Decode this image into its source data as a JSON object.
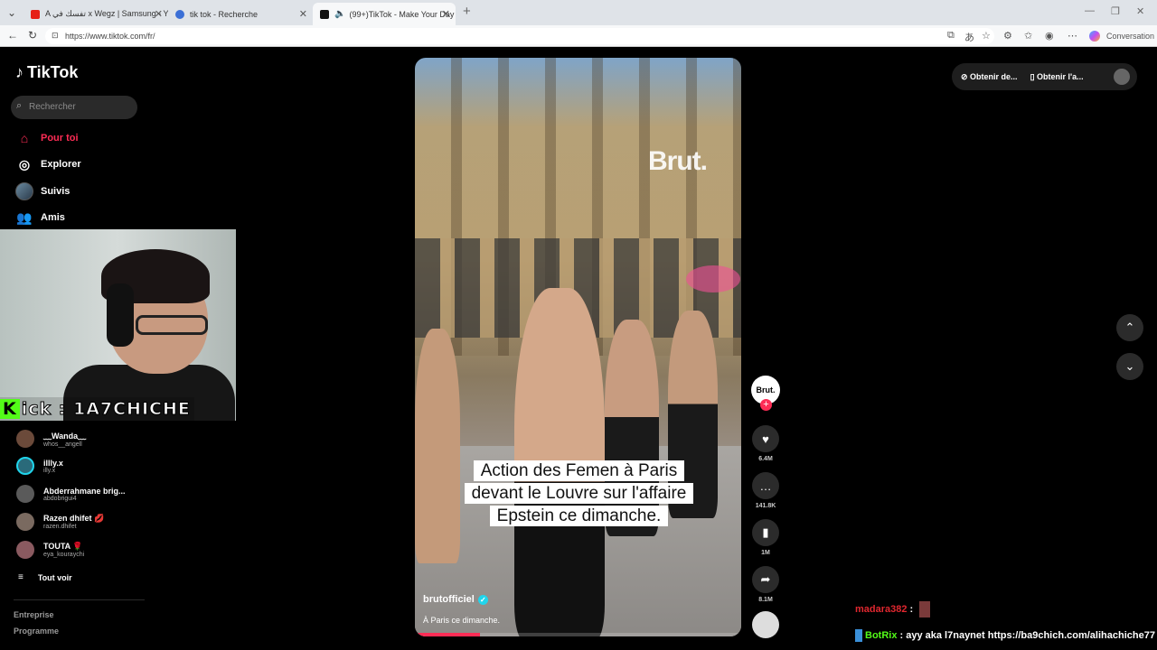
{
  "browser": {
    "tabs": [
      {
        "title": "A تفسك في x Wegz | Samsung - Yo",
        "active": false
      },
      {
        "title": "tik tok - Recherche",
        "active": false
      },
      {
        "title": "(99+)TikTok - Make Your Day",
        "active": true
      }
    ],
    "url": "https://www.tiktok.com/fr/",
    "conversation_label": "Conversation"
  },
  "sidebar": {
    "logo": "TikTok",
    "search_placeholder": "Rechercher",
    "nav": [
      {
        "label": "Pour toi",
        "icon": "home-icon",
        "active": true
      },
      {
        "label": "Explorer",
        "icon": "compass-icon",
        "active": false
      },
      {
        "label": "Suivis",
        "icon": "following-avatar",
        "active": false
      },
      {
        "label": "Amis",
        "icon": "friends-icon",
        "active": false
      }
    ],
    "accounts": [
      {
        "name": "﹏Wanda﹏",
        "handle": "whos__angell",
        "color": "#6b4a3a"
      },
      {
        "name": "illly.x",
        "handle": "illy.x",
        "color": "#2a6a7a"
      },
      {
        "name": "Abderrahmane brig...",
        "handle": "abdobrigui4",
        "color": "#5a5a5a"
      },
      {
        "name": "Razen dhifet 💋",
        "handle": "razen.dhifet",
        "color": "#7a6a60"
      },
      {
        "name": "TOUTA 🌹",
        "handle": "eya_kouraychi",
        "color": "#8a5a60"
      }
    ],
    "see_all": "Tout voir",
    "footer": [
      "Entreprise",
      "Programme"
    ]
  },
  "stream_overlay": {
    "kick_tag": "Kick : 1A7CHICHE",
    "kick_k": "K",
    "kick_rest": "ick : 1A7CHICHE"
  },
  "video": {
    "watermark": "Brut.",
    "caption_lines": [
      "Action des Femen à Paris",
      "devant le Louvre sur l'affaire",
      "Epstein ce dimanche."
    ],
    "author": "brutofficiel",
    "description": "À Paris ce dimanche.",
    "progress": 0.2
  },
  "actions": {
    "avatar_text": "Brut.",
    "likes": "6.4M",
    "comments": "141.8K",
    "saves": "1M",
    "shares": "8.1M"
  },
  "header_buttons": {
    "get_coins": "Obtenir de...",
    "get_app": "Obtenir l'a..."
  },
  "chat": [
    {
      "user": "madara382",
      "message": ""
    },
    {
      "user": "BotRix",
      "message": "ayy aka l7naynet https://ba9chich.com/alihachiche77"
    }
  ]
}
